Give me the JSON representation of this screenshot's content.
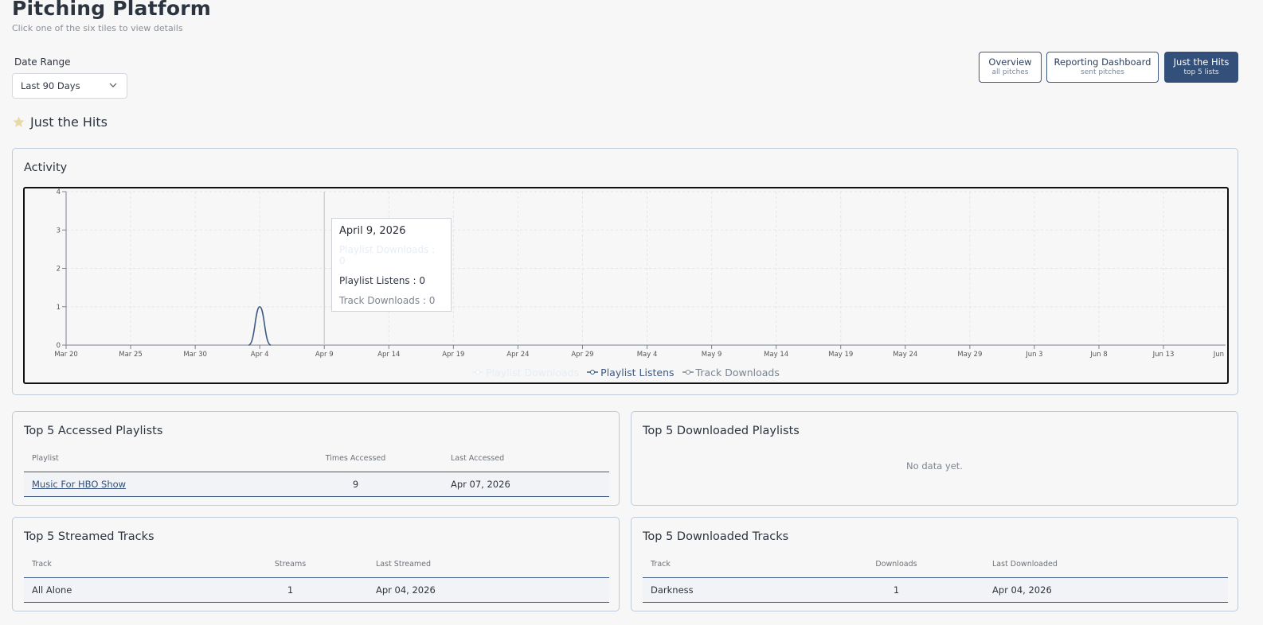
{
  "header": {
    "title": "Pitching Platform",
    "subtitle": "Click one of the six tiles to view details"
  },
  "date_range": {
    "label": "Date Range",
    "value": "Last 90 Days"
  },
  "views": [
    {
      "label": "Overview",
      "sub": "all pitches",
      "active": false
    },
    {
      "label": "Reporting Dashboard",
      "sub": "sent pitches",
      "active": false
    },
    {
      "label": "Just the Hits",
      "sub": "top 5 lists",
      "active": true
    }
  ],
  "section": {
    "title": "Just the Hits",
    "icon": "star-icon",
    "icon_color": "#e8d9a8"
  },
  "activity": {
    "title": "Activity",
    "tooltip": {
      "date": "April 9, 2026",
      "rows": [
        "Playlist Downloads : 0",
        "Playlist Listens : 0",
        "Track Downloads : 0"
      ]
    }
  },
  "chart_data": {
    "type": "area",
    "x_tick_labels": [
      "Mar 20",
      "Mar 25",
      "Mar 30",
      "Apr 4",
      "Apr 9",
      "Apr 14",
      "Apr 19",
      "Apr 24",
      "Apr 29",
      "May 4",
      "May 9",
      "May 14",
      "May 19",
      "May 24",
      "May 29",
      "Jun 3",
      "Jun 8",
      "Jun 13",
      "Jun"
    ],
    "y_ticks": [
      0,
      1,
      2,
      3,
      4
    ],
    "ylim": [
      0,
      4
    ],
    "grid": true,
    "legend_position": "bottom",
    "series": [
      {
        "name": "Playlist Downloads",
        "color": "#e6edf5",
        "peaks": []
      },
      {
        "name": "Playlist Listens",
        "color": "#3d5a83",
        "peaks": [
          {
            "x": "Apr 4",
            "value": 1
          }
        ]
      },
      {
        "name": "Track Downloads",
        "color": "#7c8592",
        "peaks": []
      }
    ]
  },
  "accessed_playlists": {
    "title": "Top 5 Accessed Playlists",
    "columns": [
      "Playlist",
      "Times Accessed",
      "Last Accessed"
    ],
    "rows": [
      [
        "Music For HBO Show",
        "9",
        "Apr 07, 2026"
      ]
    ]
  },
  "downloaded_playlists": {
    "title": "Top 5 Downloaded Playlists",
    "empty": "No data yet."
  },
  "streamed_tracks": {
    "title": "Top 5 Streamed Tracks",
    "columns": [
      "Track",
      "Streams",
      "Last Streamed"
    ],
    "rows": [
      [
        "All Alone",
        "1",
        "Apr 04, 2026"
      ]
    ]
  },
  "downloaded_tracks": {
    "title": "Top 5 Downloaded Tracks",
    "columns": [
      "Track",
      "Downloads",
      "Last Downloaded"
    ],
    "rows": [
      [
        "Darkness",
        "1",
        "Apr 04, 2026"
      ]
    ]
  }
}
